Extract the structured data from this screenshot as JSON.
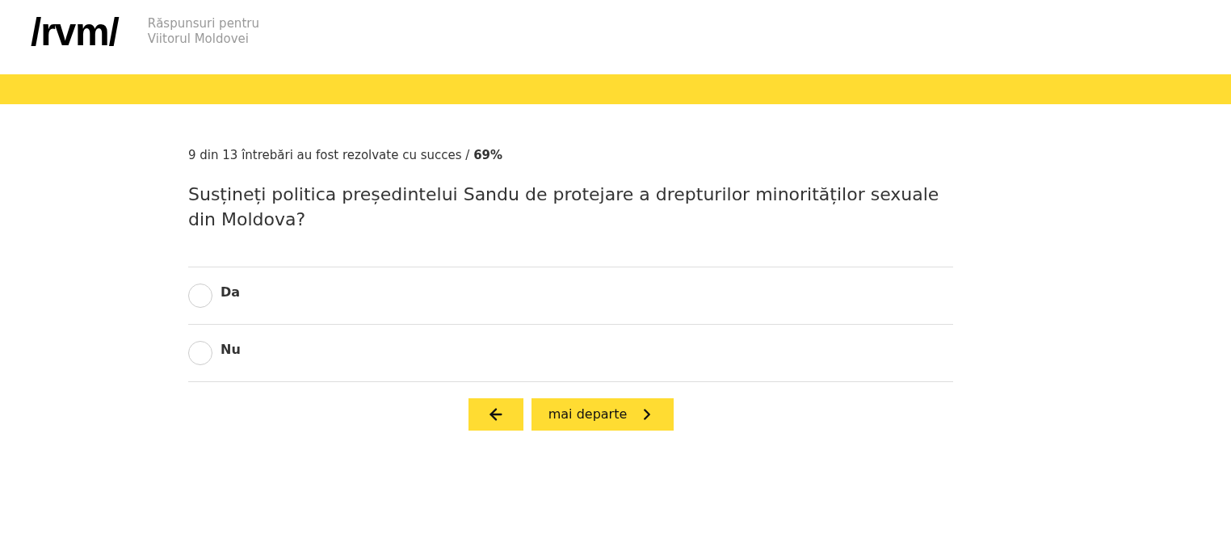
{
  "header": {
    "logo": "/rvm/",
    "tagline_lines": [
      "Răspunsuri pentru",
      "Viitorul Moldovei"
    ]
  },
  "progress": "9 din 13 întrebări au fost rezolvate cu succes / **69%**",
  "question": "Susțineți politica președintelui Sandu de protejare a drepturilor minorităților sexuale din Moldova?",
  "options": [
    {
      "label": "Da",
      "selected": false
    },
    {
      "label": "Nu",
      "selected": false
    }
  ],
  "buttons": {
    "next": "mai departe"
  }
}
